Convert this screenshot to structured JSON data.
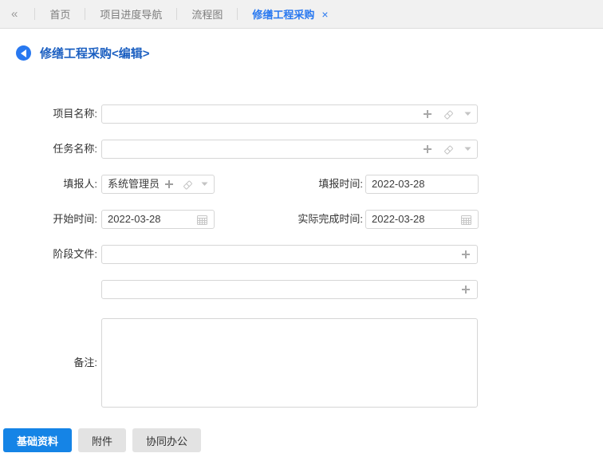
{
  "tab_bar": {
    "collapse_icon": "«",
    "tabs": [
      {
        "label": "首页",
        "active": false
      },
      {
        "label": "项目进度导航",
        "active": false
      },
      {
        "label": "流程图",
        "active": false
      },
      {
        "label": "修缮工程采购",
        "active": true,
        "close_icon": "×"
      }
    ]
  },
  "page": {
    "title": "修缮工程采购<编辑>"
  },
  "form": {
    "project_name": {
      "label": "项目名称:",
      "value": ""
    },
    "task_name": {
      "label": "任务名称:",
      "value": ""
    },
    "reporter": {
      "label": "填报人:",
      "value": "系统管理员"
    },
    "report_time": {
      "label": "填报时间:",
      "value": "2022-03-28"
    },
    "start_time": {
      "label": "开始时间:",
      "value": "2022-03-28"
    },
    "actual_finish_time": {
      "label": "实际完成时间:",
      "value": "2022-03-28"
    },
    "stage_file": {
      "label": "阶段文件:",
      "value": ""
    },
    "stage_file_2": {
      "value": ""
    },
    "remark": {
      "label": "备注:",
      "value": ""
    }
  },
  "bottom_tabs": [
    {
      "label": "基础资料",
      "active": true
    },
    {
      "label": "附件",
      "active": false
    },
    {
      "label": "协同办公",
      "active": false
    }
  ],
  "icons": {
    "plus": "plus-icon",
    "eraser": "eraser-icon",
    "dropdown": "chevron-down-icon",
    "calendar": "calendar-icon",
    "close": "close-icon",
    "collapse": "double-chevron-left-icon"
  },
  "colors": {
    "active_tab_text": "#2878f0",
    "title_text": "#1b5fc1",
    "primary_button_bg": "#1584e6",
    "tab_bar_bg": "#f1f1f1",
    "input_border": "#d6d6d6",
    "inactive_button_bg": "#e3e3e3"
  }
}
